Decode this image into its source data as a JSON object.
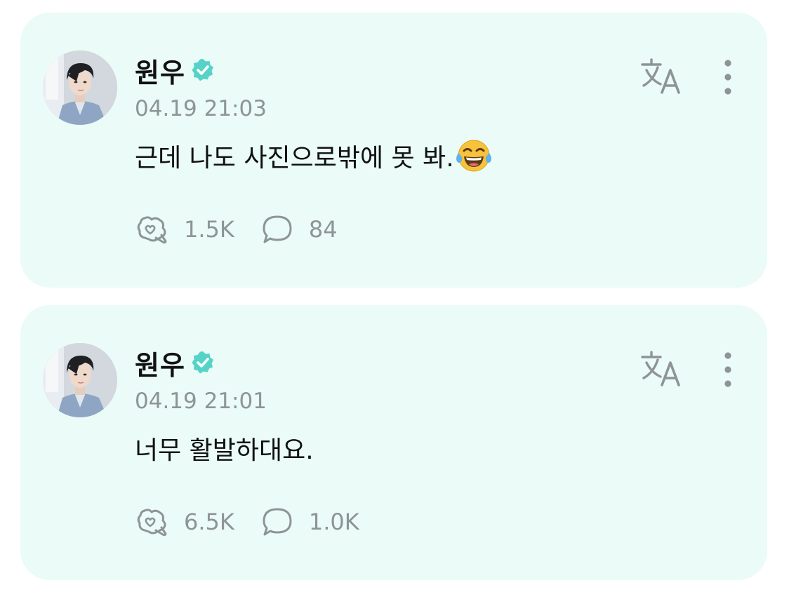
{
  "posts": [
    {
      "author": "원우",
      "timestamp": "04.19 21:03",
      "text": "근데 나도 사진으로밖에 못 봐.",
      "emoji": "face-with-tears-of-joy",
      "likes": "1.5K",
      "comments": "84"
    },
    {
      "author": "원우",
      "timestamp": "04.19 21:01",
      "text": "너무 활발하대요.",
      "likes": "6.5K",
      "comments": "1.0K"
    }
  ],
  "icons": {
    "verified": "verified-badge-icon",
    "translate": "translate-icon",
    "more": "more-options-icon",
    "like": "like-icon",
    "comment": "comment-icon"
  },
  "colors": {
    "card_background": "#eafbf8",
    "verified": "#56d3c7",
    "icon_gray": "#8e9496",
    "text": "#111111"
  }
}
